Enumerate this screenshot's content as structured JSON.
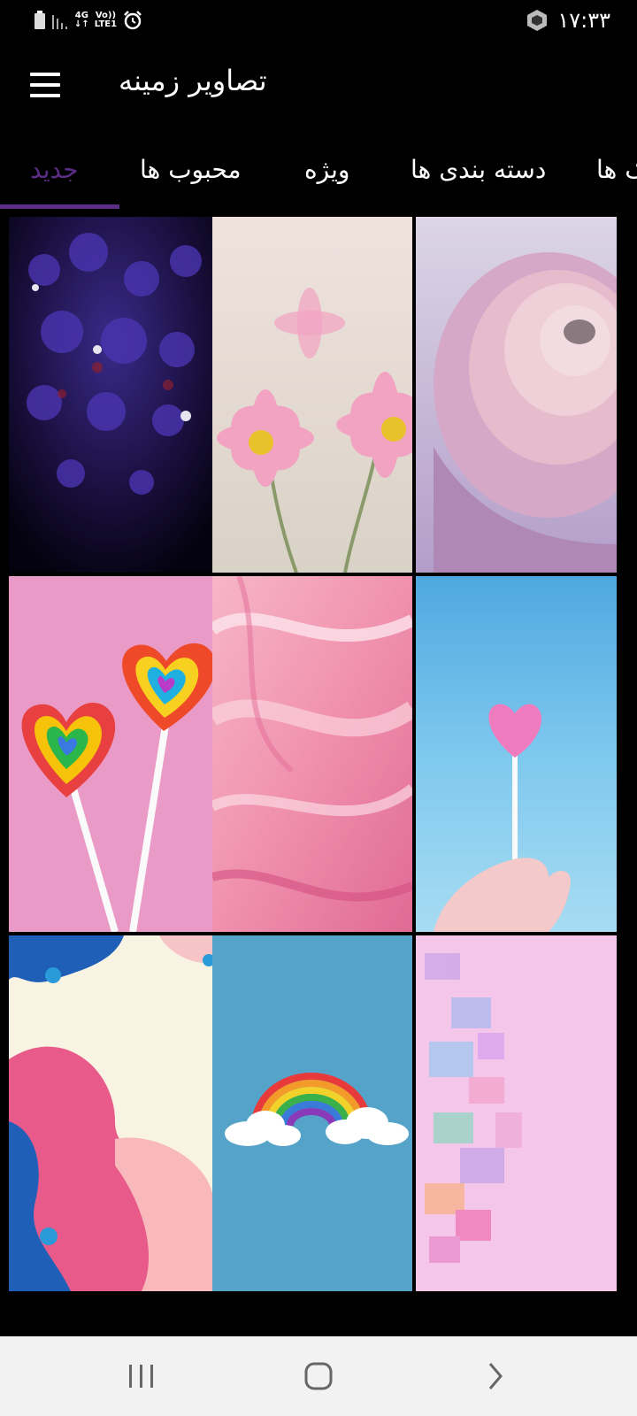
{
  "status_bar": {
    "time": "۱۷:۳۳",
    "network_label_top": "4G",
    "network_label_volte": "Vo))",
    "network_label_lte": "LTE1",
    "icons": [
      "battery-icon",
      "signal-icon",
      "alarm-icon",
      "vpn-icon"
    ]
  },
  "app_bar": {
    "title": "تصاویر زمینه",
    "menu_icon": "hamburger-menu-icon"
  },
  "tabs": [
    {
      "label": "جدید",
      "selected": true
    },
    {
      "label": "محبوب ها",
      "selected": false
    },
    {
      "label": "ویژه",
      "selected": false
    },
    {
      "label": "دسته بندی ها",
      "selected": false
    },
    {
      "label": "ک ها",
      "selected": false
    }
  ],
  "colors": {
    "accent": "#5b2d86",
    "background": "#000000",
    "nav_background": "#f2f2f2"
  },
  "wallpapers": [
    {
      "subject": "purple-flowers-wallpaper"
    },
    {
      "subject": "pink-daisies-wallpaper"
    },
    {
      "subject": "pink-rose-wallpaper"
    },
    {
      "subject": "heart-lollipops-wallpaper"
    },
    {
      "subject": "pink-marble-wallpaper"
    },
    {
      "subject": "pink-heart-lollipop-wallpaper"
    },
    {
      "subject": "abstract-shapes-wallpaper"
    },
    {
      "subject": "rainbow-clouds-wallpaper"
    },
    {
      "subject": "watercolor-wallpaper"
    }
  ],
  "nav_bar": {
    "icons": [
      "recent-apps-icon",
      "home-icon",
      "back-icon"
    ]
  }
}
